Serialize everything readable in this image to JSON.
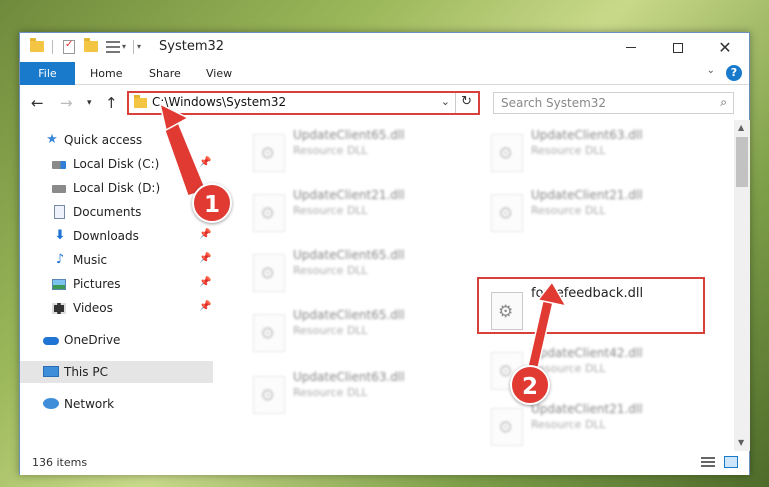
{
  "window": {
    "title": "System32"
  },
  "ribbon": {
    "tabs": [
      "File",
      "Home",
      "Share",
      "View"
    ],
    "help": "?"
  },
  "nav": {
    "address": "C:\\Windows\\System32",
    "search_placeholder": "Search System32"
  },
  "sidebar": {
    "items": [
      {
        "label": "Quick access",
        "icon": "star-icon"
      },
      {
        "label": "Local Disk (C:)",
        "icon": "drive-icon"
      },
      {
        "label": "Local Disk (D:)",
        "icon": "drive-icon"
      },
      {
        "label": "Documents",
        "icon": "documents-icon"
      },
      {
        "label": "Downloads",
        "icon": "downloads-icon"
      },
      {
        "label": "Music",
        "icon": "music-icon"
      },
      {
        "label": "Pictures",
        "icon": "pictures-icon"
      },
      {
        "label": "Videos",
        "icon": "videos-icon"
      },
      {
        "label": "OneDrive",
        "icon": "onedrive-icon"
      },
      {
        "label": "This PC",
        "icon": "pc-icon"
      },
      {
        "label": "Network",
        "icon": "network-icon"
      }
    ]
  },
  "files": [
    {
      "name": "UpdateClient65.dll",
      "type": "Resource DLL"
    },
    {
      "name": "UpdateClient63.dll",
      "type": "Resource DLL"
    },
    {
      "name": "UpdateClient21.dll",
      "type": "Resource DLL"
    },
    {
      "name": "UpdateClient21.dll",
      "type": "Resource DLL"
    },
    {
      "name": "UpdateClient65.dll",
      "type": "Resource DLL"
    },
    {
      "name": "forcefeedback.dll",
      "type": ""
    },
    {
      "name": "UpdateClient65.dll",
      "type": "Resource DLL"
    },
    {
      "name": "UpdateClient42.dll",
      "type": "Resource DLL"
    },
    {
      "name": "UpdateClient63.dll",
      "type": "Resource DLL"
    },
    {
      "name": "UpdateClient21.dll",
      "type": "Resource DLL"
    }
  ],
  "status": {
    "items_count": "136 items"
  },
  "annotations": {
    "step1": "1",
    "step2": "2",
    "color": "#e03a33"
  }
}
